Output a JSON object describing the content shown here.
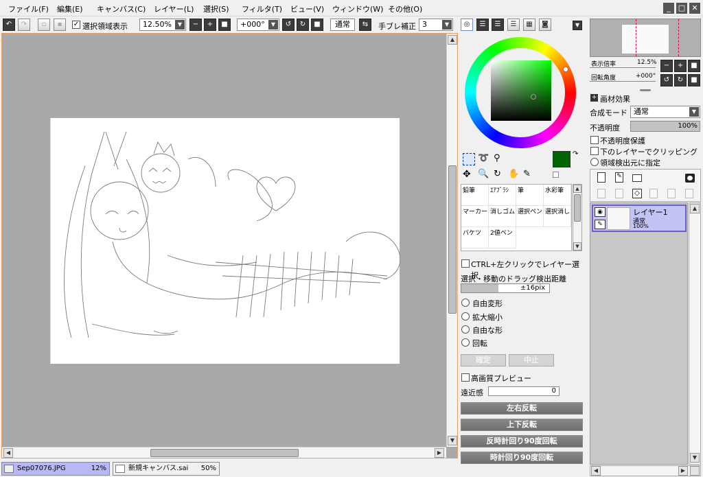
{
  "menu": [
    "ファイル(F)",
    "編集(E)",
    "キャンバス(C)",
    "レイヤー(L)",
    "選択(S)",
    "フィルタ(T)",
    "ビュー(V)",
    "ウィンドウ(W)",
    "その他(O)"
  ],
  "window_buttons": [
    "_",
    "□",
    "✕"
  ],
  "toolbar": {
    "show_selection_label": "選択領域表示",
    "zoom": "12.50%",
    "rotation": "+000°",
    "blend_mode": "通常",
    "stabilizer_label": "手ブレ補正",
    "stabilizer_value": "3"
  },
  "tabs": [
    {
      "name": "Sep07076.JPG",
      "percent": "12%"
    },
    {
      "name": "新規キャンバス.sai",
      "percent": "50%"
    }
  ],
  "tools": {
    "selected_color": "#006400",
    "secondary_color": "#e8e0b0",
    "brushes": [
      [
        "鉛筆",
        "ｴｱﾌﾞﾗｼ",
        "筆",
        "水彩筆"
      ],
      [
        "マーカー",
        "消しゴム",
        "選択ペン",
        "選択消し"
      ],
      [
        "バケツ",
        "2値ペン",
        "",
        ""
      ]
    ],
    "ctrl_click_label": "CTRL+左クリックでレイヤー選択",
    "drag_distance_label": "選択・移動のドラッグ検出距離",
    "drag_distance_value": "±16pix",
    "transform_options": [
      "自由変形",
      "拡大縮小",
      "自由な形",
      "回転"
    ],
    "confirm_label": "確定",
    "cancel_label": "中止",
    "hq_preview_label": "高画質プレビュー",
    "perspective_label": "遠近感",
    "perspective_value": "0",
    "flip_h": "左右反転",
    "flip_v": "上下反転",
    "rotate_ccw": "反時計回り90度回転",
    "rotate_cw": "時計回り90度回転"
  },
  "navigator": {
    "zoom_label": "表示倍率",
    "zoom_value": "12.5%",
    "rotation_label": "回転角度",
    "rotation_value": "+000°"
  },
  "layer_panel": {
    "effects_label": "画材効果",
    "blend_label": "合成モード",
    "blend_value": "通常",
    "opacity_label": "不透明度",
    "opacity_value": "100%",
    "opacity_fraction": 1.0,
    "protect_opacity": "不透明度保護",
    "clip_lower": "下のレイヤーでクリッピング",
    "region_source": "領域検出元に指定",
    "layers": [
      {
        "name": "レイヤー1",
        "mode": "通常",
        "opacity": "100%"
      }
    ]
  }
}
